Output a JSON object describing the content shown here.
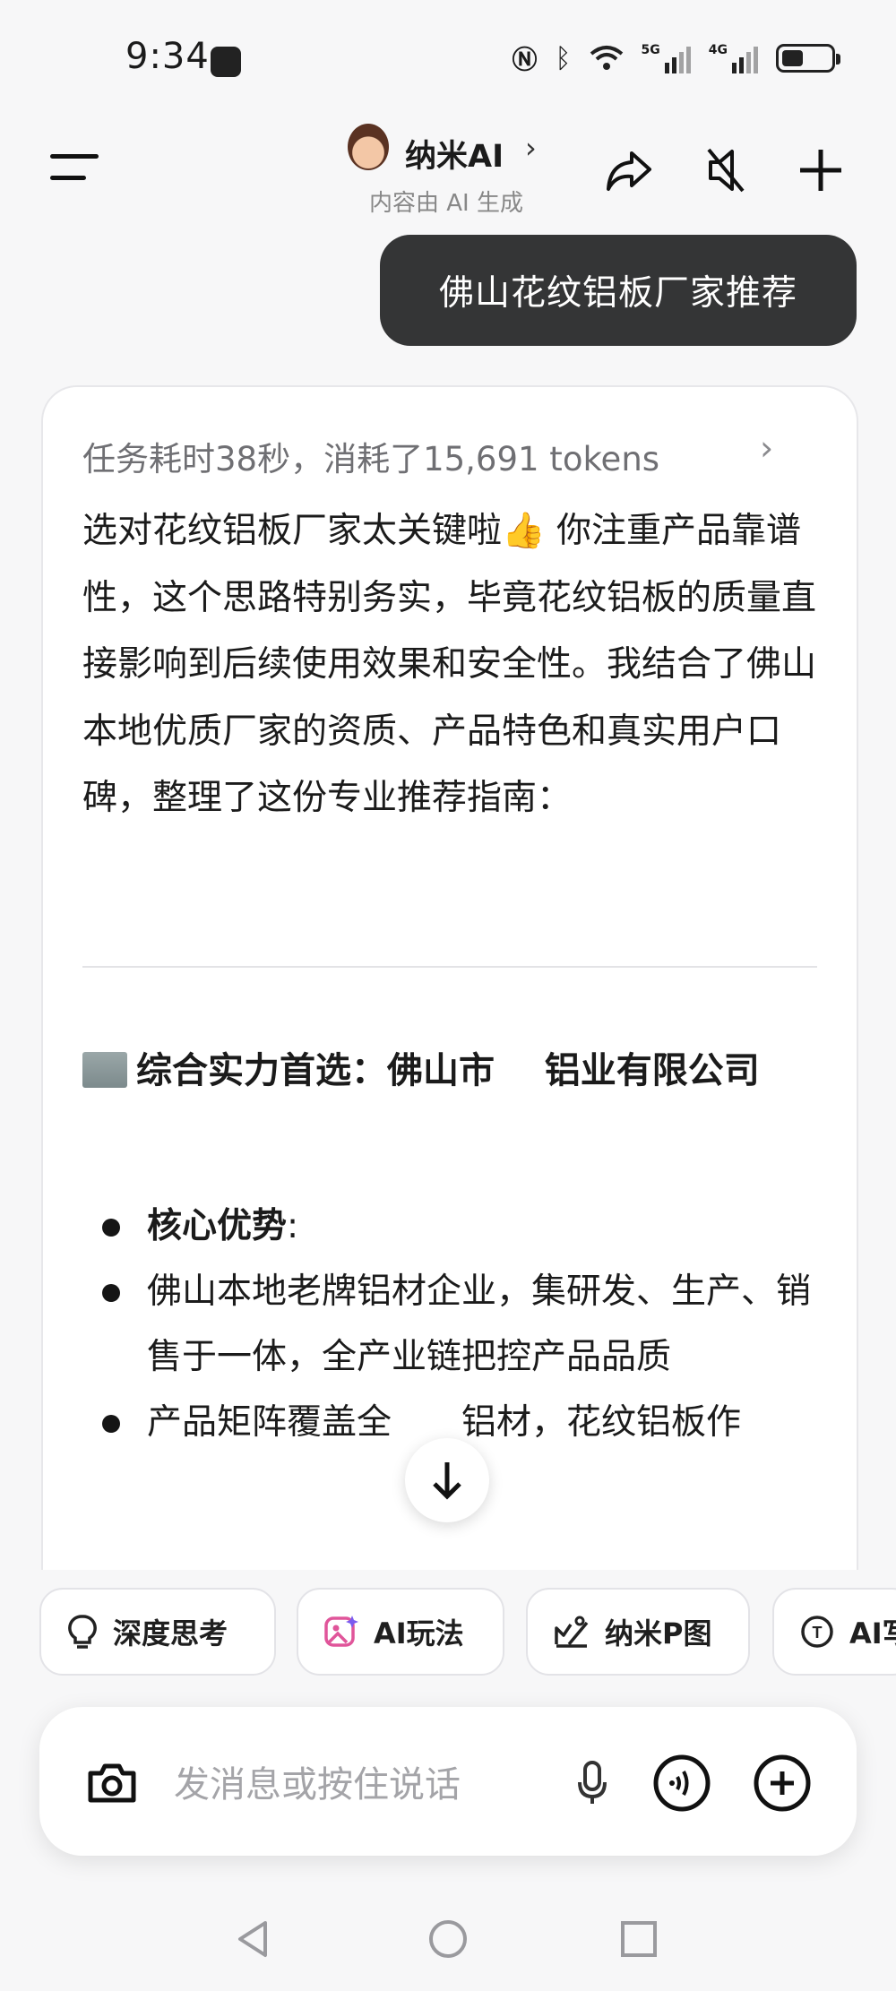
{
  "status_bar": {
    "time": "9:34",
    "network_1": "5G",
    "network_2": "4G",
    "battery_level": 0.45
  },
  "header": {
    "title": "纳米AI",
    "chevron": "›",
    "subtitle": "内容由 AI 生成",
    "icons": [
      "menu-icon",
      "share-icon",
      "mute-icon",
      "plus-icon"
    ]
  },
  "user_message": "佛山花纹铝板厂家推荐",
  "response": {
    "task_info": "任务耗时38秒，消耗了15,691 tokens",
    "task_chevron": "›",
    "intro": "选对花纹铝板厂家太关键啦👍 你注重产品靠谱性，这个思路特别务实，毕竟花纹铝板的质量直接影响到后续使用效果和安全性。我结合了佛山本地优质厂家的资质、产品特色和真实用户口碑，整理了这份专业推荐指南：",
    "section_title": "综合实力首选：佛山市",
    "section_title_tail": "铝业有限公司",
    "bullets": [
      {
        "label": "核心优势",
        "text": ":"
      },
      {
        "label": "",
        "text": "佛山本地老牌铝材企业，集研发、生产、销售于一体，全产业链把控产品品质"
      },
      {
        "label": "",
        "text": "产品矩阵覆盖全　　铝材，花纹铝板作"
      }
    ]
  },
  "chips": [
    {
      "label": "深度思考",
      "icon": "bulb-icon"
    },
    {
      "label": "AI玩法",
      "icon": "magic-image-icon"
    },
    {
      "label": "纳米P图",
      "icon": "photo-edit-icon"
    },
    {
      "label": "AI写",
      "icon": "ai-write-icon"
    }
  ],
  "input": {
    "placeholder": "发消息或按住说话",
    "icons": [
      "camera-icon",
      "mic-icon",
      "voice-call-icon",
      "add-icon"
    ]
  },
  "nav": [
    "back-icon",
    "home-icon",
    "recents-icon"
  ],
  "colors": {
    "background": "#f7f7f8",
    "bubble": "#343536",
    "text": "#1b1b1b",
    "muted": "#8a8a8e"
  }
}
